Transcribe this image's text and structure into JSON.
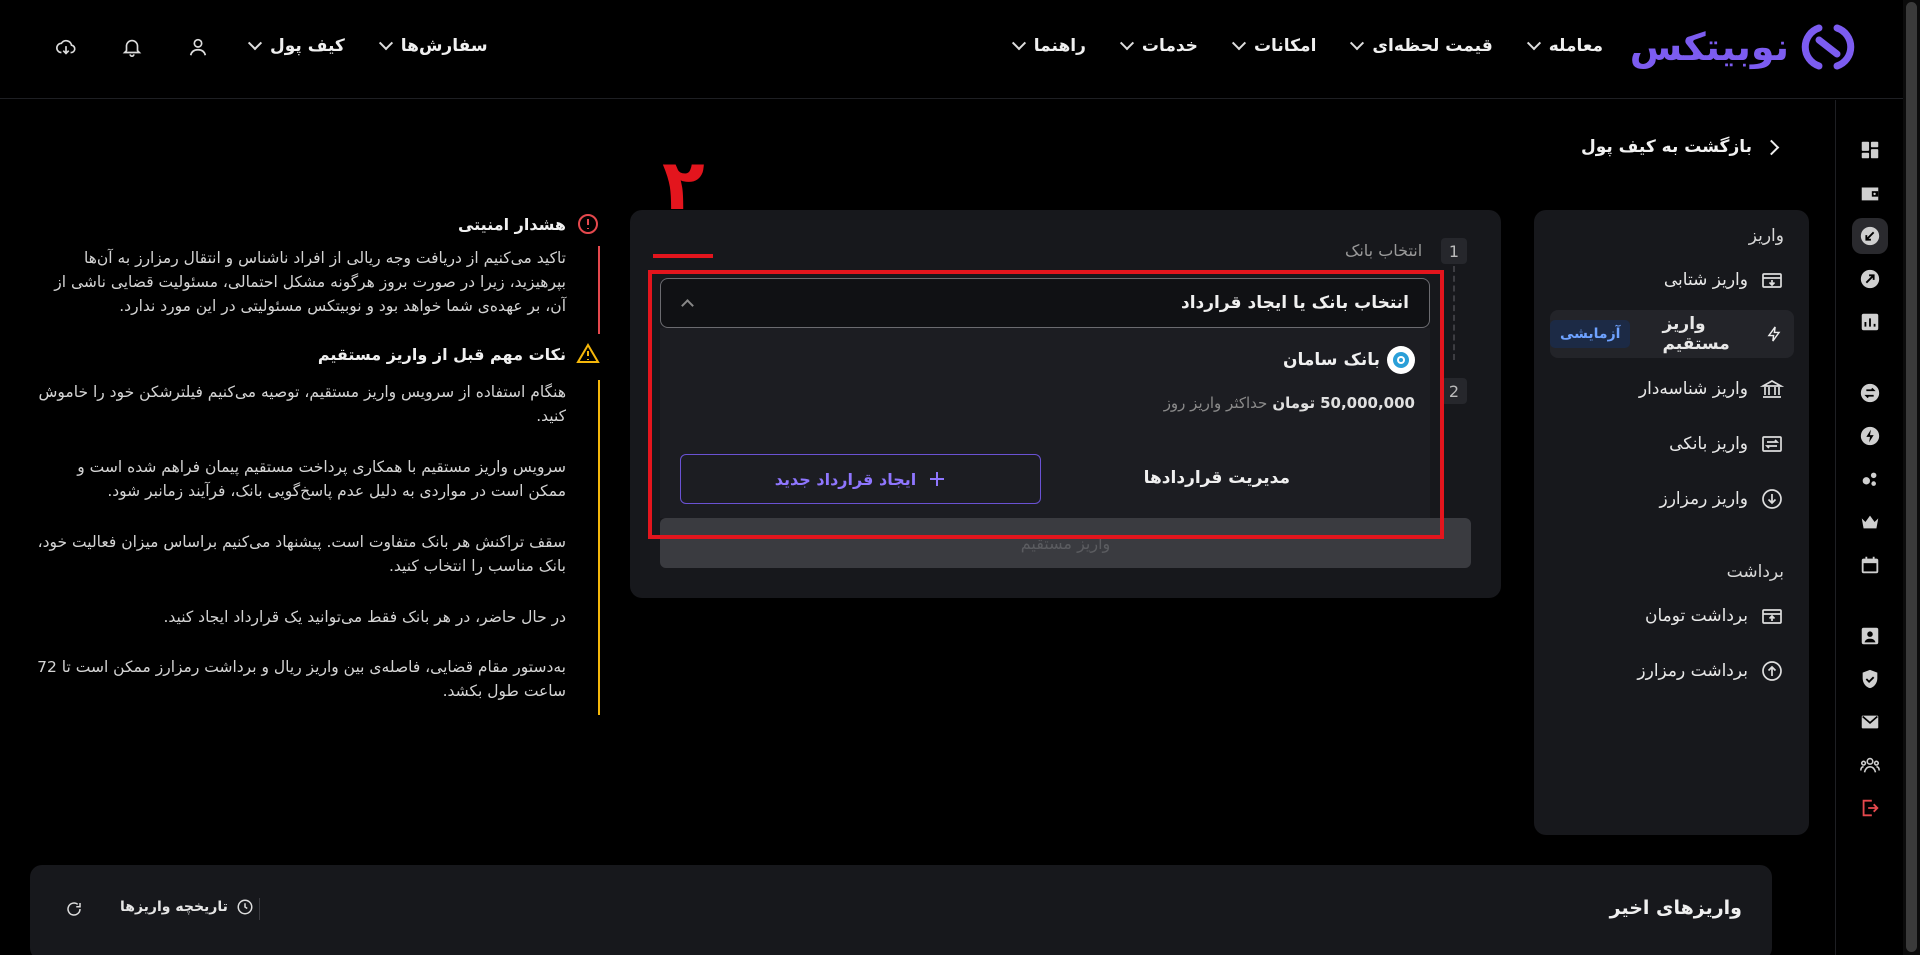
{
  "brand": {
    "name": "نوبیتکس"
  },
  "nav": {
    "items": [
      {
        "label": "معامله"
      },
      {
        "label": "قیمت لحظه‌ای"
      },
      {
        "label": "امکانات"
      },
      {
        "label": "خدمات"
      },
      {
        "label": "راهنما"
      }
    ],
    "left_items": [
      {
        "label": "سفارش‌ها"
      },
      {
        "label": "کیف پول"
      }
    ]
  },
  "back": {
    "label": "بازگشت به کیف پول"
  },
  "side": {
    "deposit_title": "واریز",
    "withdraw_title": "برداشت",
    "items": [
      {
        "label": "واریز شتابی"
      },
      {
        "label": "واریز مستقیم",
        "badge": "آزمایشی"
      },
      {
        "label": "واریز شناسه‌دار"
      },
      {
        "label": "واریز بانکی"
      },
      {
        "label": "واریز رمزارز"
      },
      {
        "label": "برداشت تومان"
      },
      {
        "label": "برداشت رمزارز"
      }
    ]
  },
  "card": {
    "step1_num": "1",
    "step1_label": "انتخاب بانک",
    "step2_num": "2",
    "dropdown_label": "انتخاب بانک یا ایجاد قرارداد",
    "bank_name": "بانک سامان",
    "limit_amount": "50,000,000",
    "limit_unit": "تومان",
    "limit_note": "حداکثر واریز روز",
    "manage_label": "مدیریت قراردادها",
    "new_contract_label": "ایجاد قرارداد جدید",
    "submit_label": "واریز مستقیم",
    "annotation_number": "۲"
  },
  "info": {
    "security_title": "هشدار امنیتی",
    "security_text": "تاکید می‌کنیم از دریافت وجه ریالی از افراد ناشناس و انتقال رمزارز به آن‌ها بپرهیزید، زیرا در صورت بروز هرگونه مشکل احتمالی، مسئولیت قضایی ناشی از آن، بر عهده‌ی شما خواهد بود و نوبیتکس مسئولیتی در این مورد ندارد.",
    "tips_title": "نکات مهم قبل از واریز مستقیم",
    "tips": [
      "هنگام استفاده از سرویس واریز مستقیم، توصیه می‌کنیم فیلترشکن خود را خاموش کنید.",
      "سرویس واریز مستقیم با همکاری پرداخت مستقیم پیمان فراهم شده است و ممکن است در مواردی به دلیل عدم پاسخ‌گویی بانک، فرآیند زمانبر شود.",
      "سقف تراکنش هر بانک متفاوت است. پیشنهاد می‌کنیم براساس میزان فعالیت خود، بانک مناسب را انتخاب کنید.",
      "در حال حاضر، در هر بانک فقط می‌توانید یک قرارداد ایجاد کنید.",
      "به‌دستور مقام قضایی، فاصله‌ی بین واریز ریال و برداشت رمزارز ممکن است تا 72 ساعت طول بکشد."
    ]
  },
  "recent": {
    "title": "واریزهای اخیر",
    "history_label": "تاریخچه واریزها"
  },
  "colors": {
    "accent": "#7c5cf0",
    "annotation": "#e3151d",
    "warning": "#f5b70a",
    "danger": "#e5484d",
    "badge_text": "#6ea2ff"
  }
}
